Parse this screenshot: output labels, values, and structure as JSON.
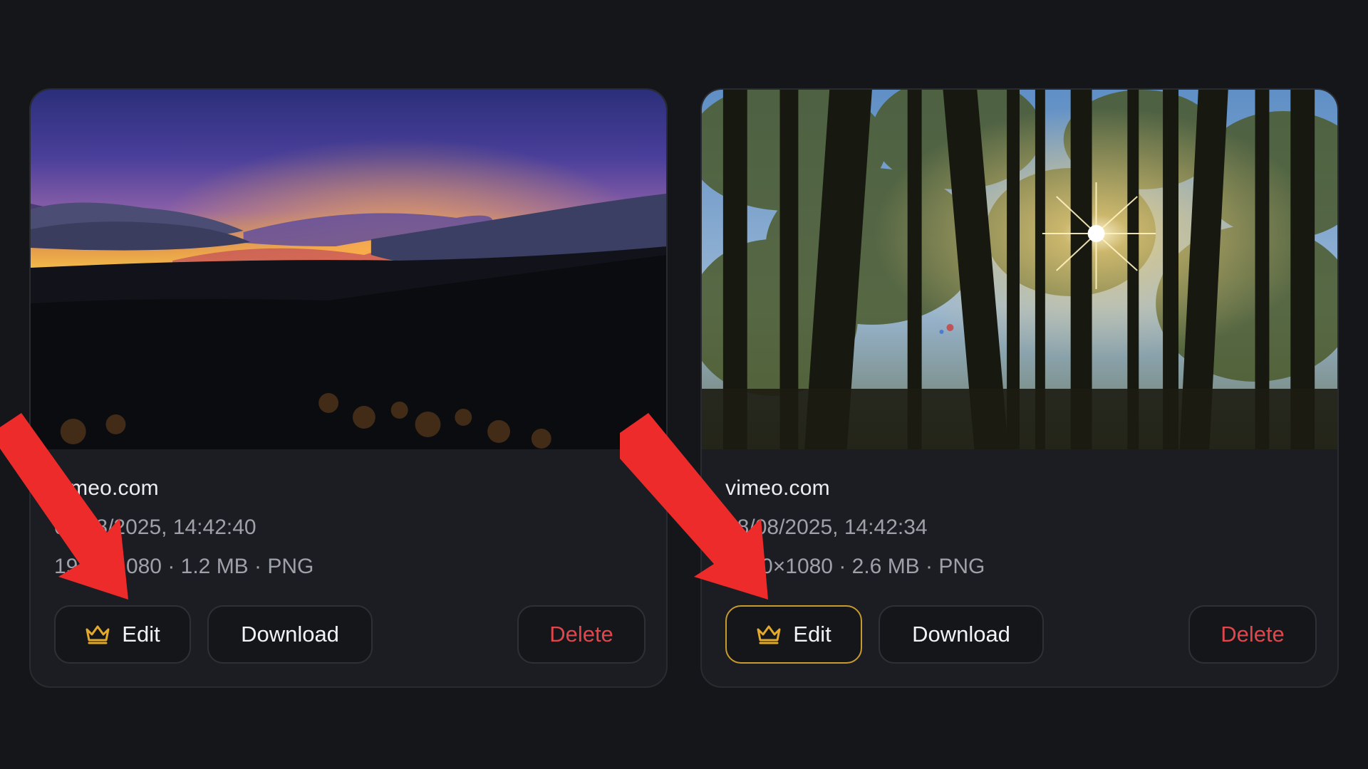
{
  "cards": [
    {
      "source": "vimeo.com",
      "date": "08/08/2025, 14:42:40",
      "info": "1920×1080 · 1.2 MB · PNG",
      "thumbnail": "sunset-over-clouds-landscape"
    },
    {
      "source": "vimeo.com",
      "date": "08/08/2025, 14:42:34",
      "info": "1920×1080 · 2.6 MB · PNG",
      "thumbnail": "sun-through-pine-forest"
    }
  ],
  "actions": {
    "edit_label": "Edit",
    "download_label": "Download",
    "delete_label": "Delete"
  },
  "icons": {
    "edit": "crown-icon",
    "annotation": "red-arrow"
  },
  "colors": {
    "background": "#15161a",
    "card": "#1c1d22",
    "accent_gold": "#c99a2e",
    "delete_red": "#e0474d",
    "arrow_red": "#ee2b2b"
  }
}
